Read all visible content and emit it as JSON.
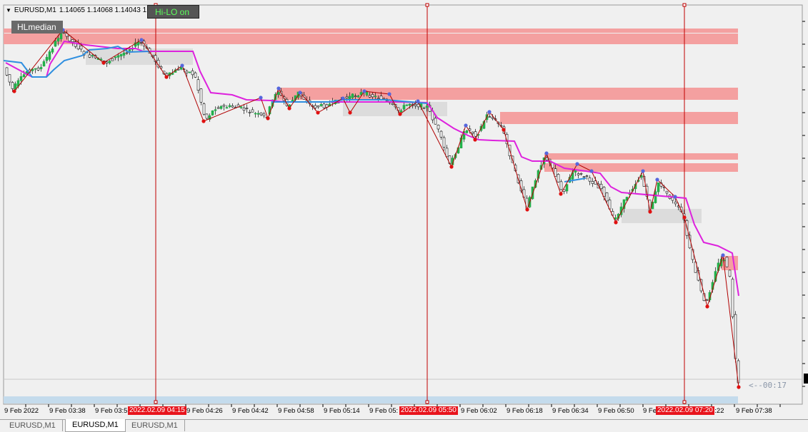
{
  "chart_header": {
    "symbol": "EURUSD,M1",
    "ohlc": "1.14065 1.14068 1.14043 1.14",
    "dropdown_icon": "triangle-down-icon"
  },
  "buttons": {
    "hilo_label": "Hi-LO on",
    "hlmedian_label": "HLmedian"
  },
  "countdown": "<--00:17",
  "colors": {
    "background": "#f0f0f0",
    "zone": "#f4a0a0",
    "range_box": "#dcdcdc",
    "bull_candle": "#22b04a",
    "bear_candle": "#c80000",
    "median_line": "#dd22dd",
    "blue_line": "#2f8fe0",
    "vline": "#c00000",
    "high_dot": "#5566dd",
    "low_dot": "#e01010",
    "highlight_tag": "#e8141c"
  },
  "time_axis": {
    "labels": [
      "9 Feb 2022",
      "9 Feb 03:38",
      "9 Feb 03:5",
      "9 Feb 04:26",
      "9 Feb 04:42",
      "9 Feb 04:58",
      "9 Feb 05:14",
      "9 Feb 05:",
      "9 Feb 06:02",
      "9 Feb 06:18",
      "9 Feb 06:34",
      "9 Feb 06:50",
      "9 Fe",
      "7:22",
      "9 Feb 07:38"
    ],
    "highlighted": [
      "2022.02.09 04:15",
      "2022.02.09 05:50",
      "2022.02.09 07:20"
    ]
  },
  "tabs": [
    "EURUSD,M1",
    "EURUSD,M1",
    "EURUSD,M1"
  ],
  "active_tab_index": 1,
  "chart_data": {
    "type": "candlestick",
    "symbol": "EURUSD",
    "timeframe": "M1",
    "last_ohlc": {
      "open": 1.14065,
      "high": 1.14068,
      "low": 1.14043
    },
    "x_range": [
      "9 Feb 03:22",
      "9 Feb 07:42"
    ],
    "vertical_lines": [
      "2022.02.09 04:15",
      "2022.02.09 05:50",
      "2022.02.09 07:20"
    ],
    "series": [
      {
        "name": "HLmedian",
        "color": "#dd22dd"
      },
      {
        "name": "",
        "color": "#2f8fe0"
      }
    ],
    "grid": false
  }
}
